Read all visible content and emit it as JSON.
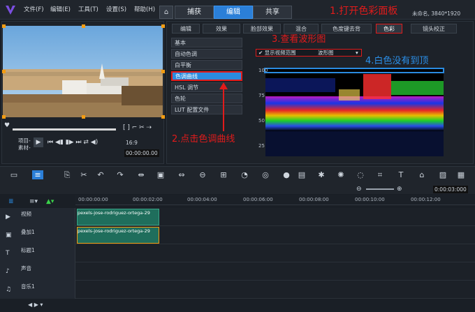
{
  "window": {
    "menu": [
      "文件(F)",
      "编辑(E)",
      "工具(T)",
      "设置(S)",
      "帮助(H)"
    ],
    "tabs": [
      "捕获",
      "编辑",
      "共享"
    ],
    "filename": "未命名, 3840*1920"
  },
  "annotations": {
    "a1": "1.打开色彩面板",
    "a2": "2.点击色调曲线",
    "a3": "3.查看波形图",
    "a4": "4.白色没有到顶"
  },
  "preview": {
    "project_label": "项目-",
    "clip_label": "素材-",
    "timecode": "00:00:00.00",
    "zoom": "16:9"
  },
  "fx_tabs": [
    "编辑",
    "效果",
    "脸部效果",
    "混合",
    "色度键去背",
    "色彩",
    "镜头校正"
  ],
  "side_items": [
    "基本",
    "自动色调",
    "白平衡",
    "色调曲线",
    "HSL 调节",
    "色轮",
    "LUT 配置文件"
  ],
  "scope": {
    "show_range": "显示视频范围",
    "mode": "波形图",
    "yticks": [
      "100",
      "75",
      "50",
      "25"
    ]
  },
  "timeline": {
    "timecode": "0:00:03:000",
    "ruler": [
      "00:00:00:00",
      "00:00:02:00",
      "00:00:04:00",
      "00:00:06:00",
      "00:00:08:00",
      "00:00:10:00",
      "00:00:12:00"
    ],
    "tracks": [
      {
        "name": "视频",
        "clip": "pexels-jose-rodriguez-ortega-29"
      },
      {
        "name": "叠加1",
        "clip": "pexels-jose-rodriguez-ortega-29"
      },
      {
        "name": "标题1",
        "clip": ""
      },
      {
        "name": "声音",
        "clip": ""
      },
      {
        "name": "音乐1",
        "clip": ""
      }
    ]
  },
  "colors": {
    "accent": "#2b7fd8",
    "annotation_red": "#e11b1b",
    "annotation_blue": "#2b8fe8",
    "clip": "#1f6e5c"
  }
}
